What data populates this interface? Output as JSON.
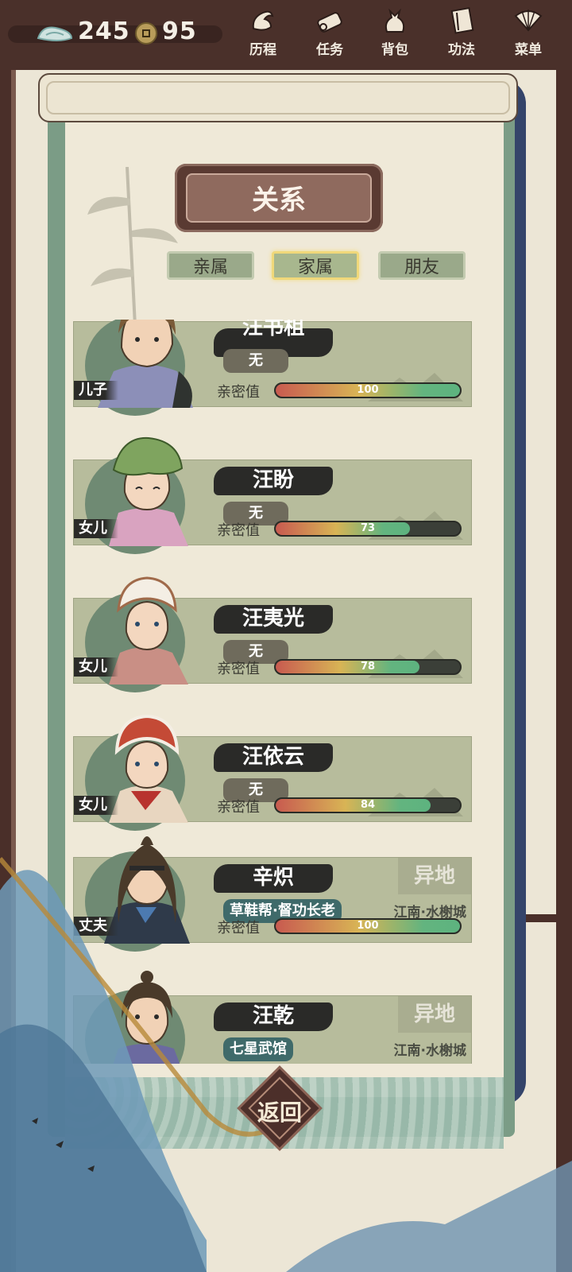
{
  "currency": {
    "jade": "245",
    "coins": "95"
  },
  "menu": [
    {
      "label": "历程",
      "icon": "journey-icon"
    },
    {
      "label": "任务",
      "icon": "task-scroll-icon"
    },
    {
      "label": "背包",
      "icon": "bag-icon"
    },
    {
      "label": "功法",
      "icon": "book-icon"
    },
    {
      "label": "菜单",
      "icon": "fan-icon"
    }
  ],
  "title": "关系",
  "tabs": [
    {
      "label": "亲属",
      "active": false
    },
    {
      "label": "家属",
      "active": true
    },
    {
      "label": "朋友",
      "active": false
    }
  ],
  "intimacy_label": "亲密值",
  "people": [
    {
      "name": "汪书柤",
      "relation": "儿子",
      "status": "无",
      "intimacy": 100
    },
    {
      "name": "汪盼",
      "relation": "女儿",
      "status": "无",
      "intimacy": 73
    },
    {
      "name": "汪夷光",
      "relation": "女儿",
      "status": "无",
      "intimacy": 78
    },
    {
      "name": "汪依云",
      "relation": "女儿",
      "status": "无",
      "intimacy": 84
    },
    {
      "name": "辛炽",
      "relation": "丈夫",
      "org": "草鞋帮·督功长老",
      "away": "异地",
      "place": "江南·水榭城",
      "intimacy": 100
    },
    {
      "name": "汪乾",
      "relation": "",
      "org": "七星武馆",
      "away": "异地",
      "place": "江南·水榭城"
    }
  ],
  "back_label": "返回",
  "colors": {
    "topbar": "#4a302a",
    "card": "#b7bc9c",
    "tab_active_glow": "#f0d87a",
    "org_pill": "#3f6a6a"
  }
}
